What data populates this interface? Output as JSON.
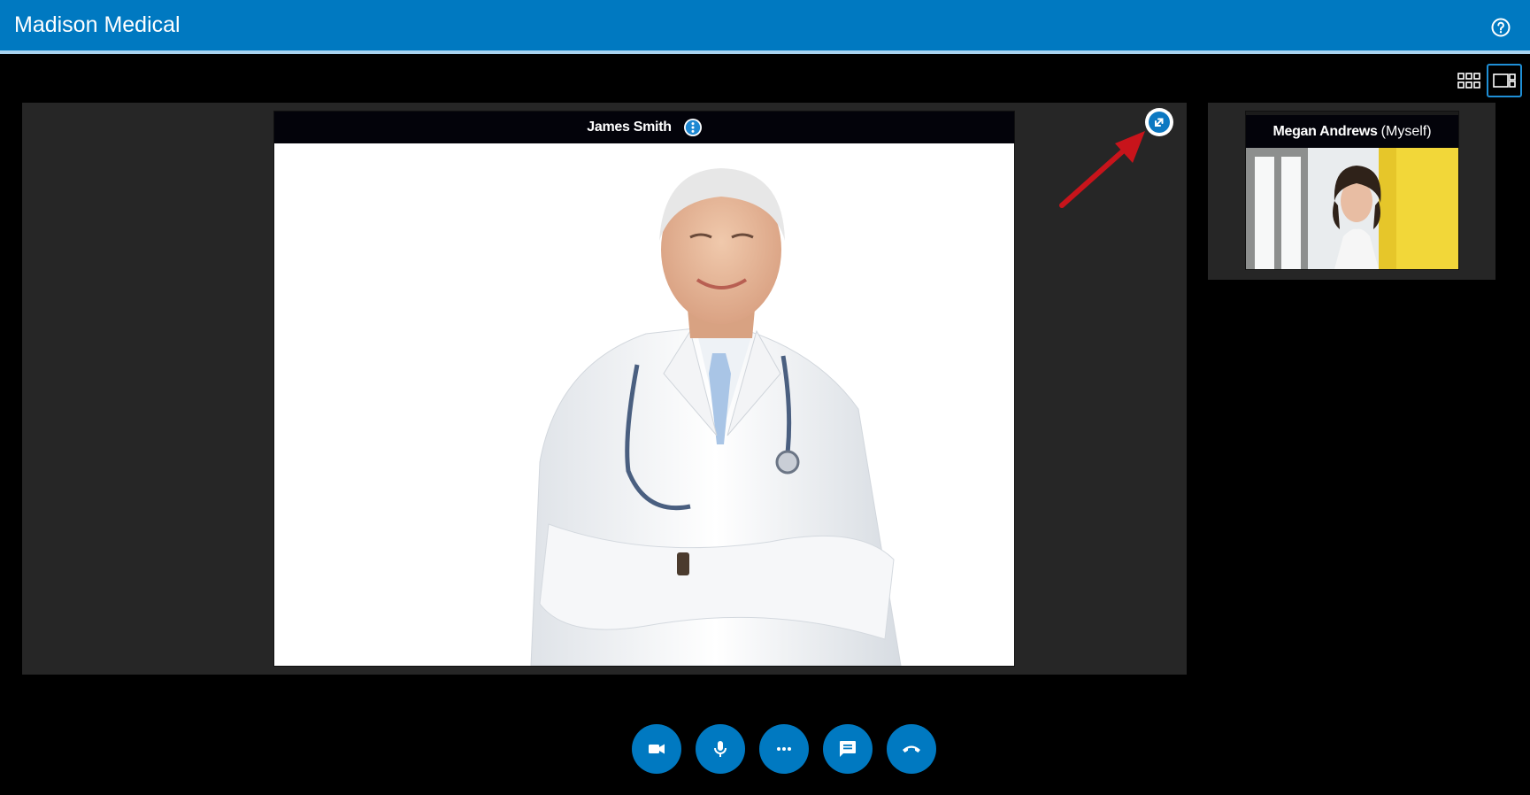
{
  "header": {
    "title": "Madison Medical",
    "help_icon": "help-circle-icon",
    "background_color": "#0079c1"
  },
  "view_modes": [
    {
      "icon": "grid-view-icon",
      "active": false
    },
    {
      "icon": "speaker-view-icon",
      "active": true
    }
  ],
  "main_participant": {
    "name": "James Smith",
    "info_icon": "more-vertical-icon",
    "popout_icon": "pop-out-icon"
  },
  "self_view": {
    "name": "Megan Andrews",
    "tag": "(Myself)"
  },
  "controls": [
    {
      "icon": "video-camera-icon"
    },
    {
      "icon": "microphone-icon"
    },
    {
      "icon": "more-options-icon"
    },
    {
      "icon": "chat-icon"
    },
    {
      "icon": "hang-up-icon"
    }
  ],
  "annotation": {
    "arrow_color": "#c8141b"
  }
}
